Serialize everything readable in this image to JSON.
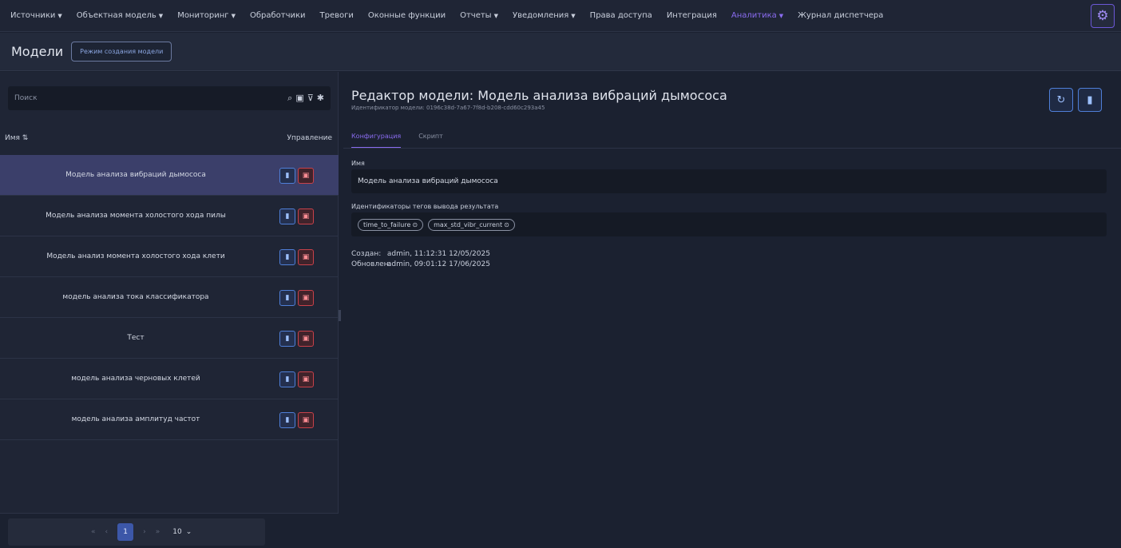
{
  "nav": {
    "items": [
      {
        "label": "Источники",
        "dropdown": true
      },
      {
        "label": "Объектная модель",
        "dropdown": true
      },
      {
        "label": "Мониторинг",
        "dropdown": true
      },
      {
        "label": "Обработчики",
        "dropdown": false
      },
      {
        "label": "Тревоги",
        "dropdown": false
      },
      {
        "label": "Оконные функции",
        "dropdown": false
      },
      {
        "label": "Отчеты",
        "dropdown": true
      },
      {
        "label": "Уведомления",
        "dropdown": true
      },
      {
        "label": "Права доступа",
        "dropdown": false
      },
      {
        "label": "Интеграция",
        "dropdown": false
      },
      {
        "label": "Аналитика",
        "dropdown": true,
        "active": true
      },
      {
        "label": "Журнал диспетчера",
        "dropdown": false
      }
    ],
    "accent": "#8a6cf0"
  },
  "header": {
    "title": "Модели",
    "mode_button": "Режим создания модели"
  },
  "left": {
    "search_placeholder": "Поиск",
    "col_name": "Имя ⇅",
    "col_actions": "Управление",
    "models": [
      "Модель анализа вибраций дымососа",
      "Модель анализа момента холостого хода пилы",
      "Модель анализ момента холостого хода клети",
      "модель анализа тока классификатора",
      "Тест",
      "модель анализа черновых клетей",
      "модель анализа амплитуд частот"
    ],
    "pager": {
      "first": "«",
      "prev": "‹",
      "current": "1",
      "next": "›",
      "last": "»",
      "per_page": "10"
    }
  },
  "editor": {
    "title": "Редактор модели: Модель анализа вибраций дымососа",
    "id_line": "Идентификатор модели: 0196c38d-7a67-7f8d-b208-cdd60c293a45",
    "tabs": [
      "Конфигурация",
      "Скрипт"
    ],
    "name_label": "Имя",
    "name_value": "Модель анализа вибраций дымососа",
    "tags_label": "Идентификаторы тегов вывода результата",
    "tags": [
      "time_to_failure",
      "max_std_vibr_current"
    ],
    "created_label": "Создан:",
    "created_value": "admin, 11:12:31 12/05/2025",
    "updated_label": "Обновлен:",
    "updated_value": "admin, 09:01:12 17/06/2025"
  }
}
